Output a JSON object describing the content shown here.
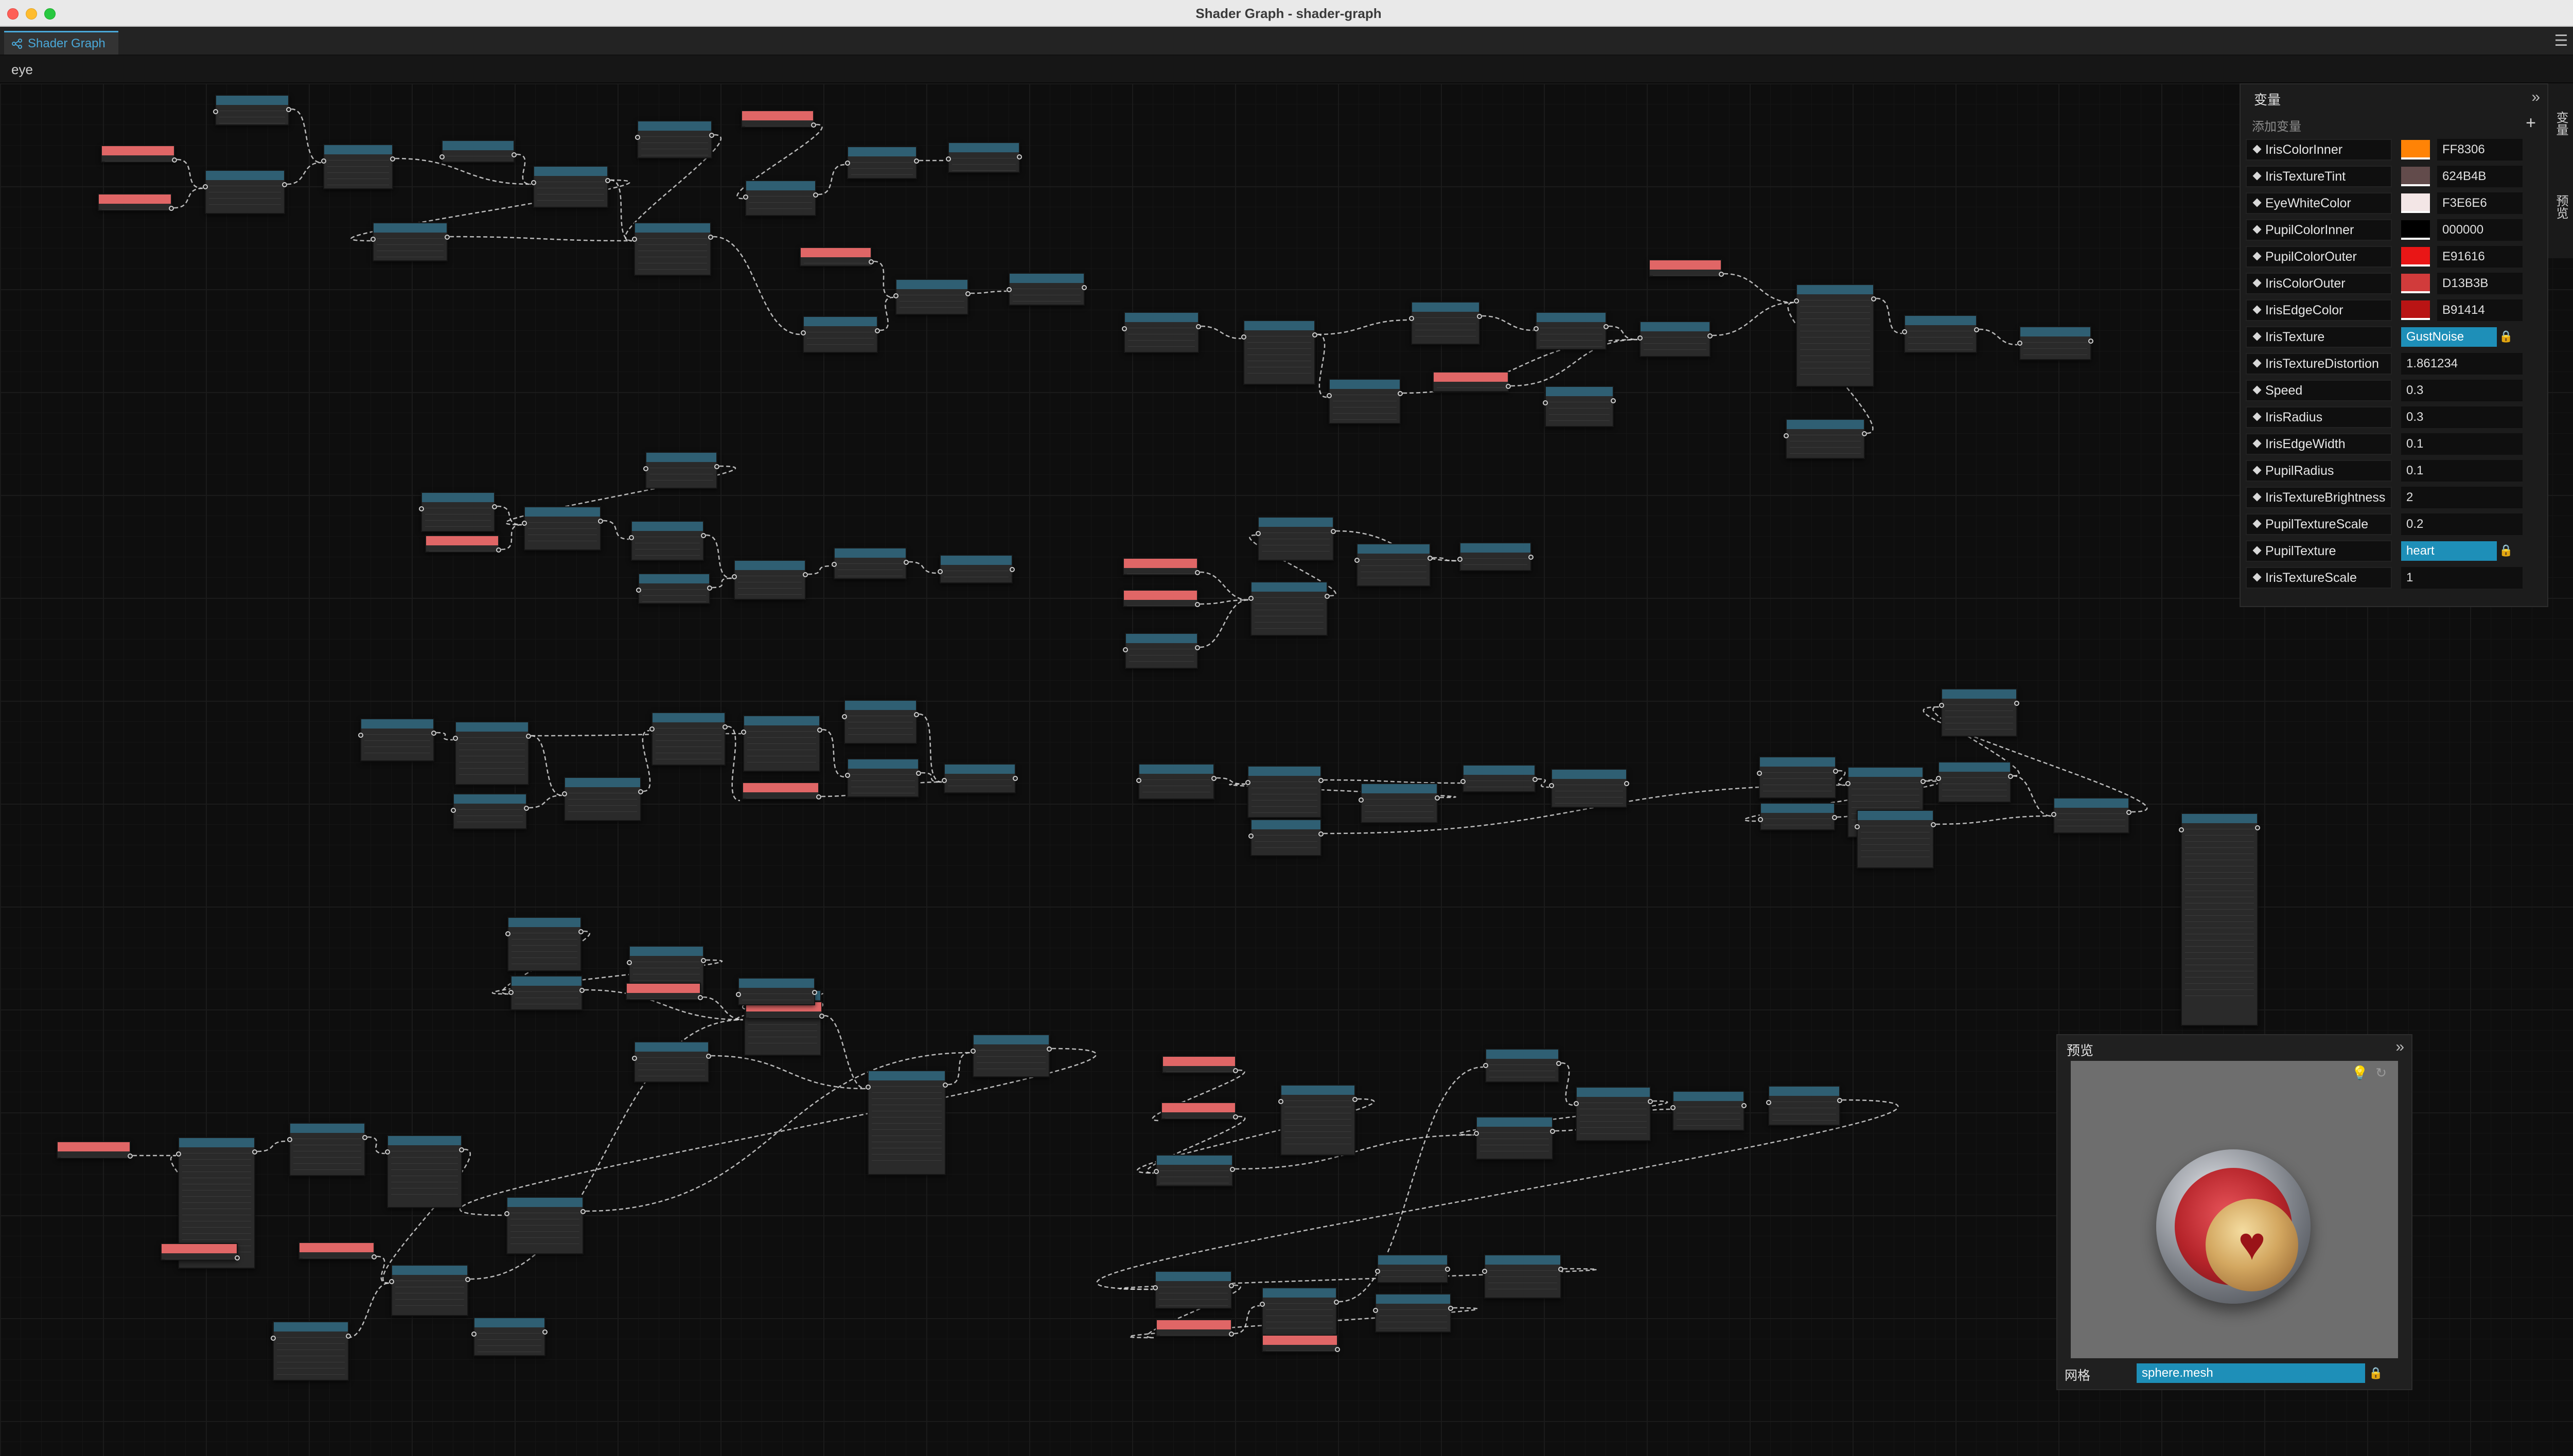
{
  "window": {
    "title": "Shader Graph - shader-graph"
  },
  "tabs": [
    {
      "label": "Shader Graph",
      "icon": "graph-icon"
    }
  ],
  "breadcrumb": "eye",
  "variables_panel": {
    "title": "变量",
    "add_label": "添加变量",
    "variables": [
      {
        "name": "IrisColorInner",
        "type": "color",
        "value": "FF8306",
        "color": "#FF8306"
      },
      {
        "name": "IrisTextureTint",
        "type": "color",
        "value": "624B4B",
        "color": "#624B4B"
      },
      {
        "name": "EyeWhiteColor",
        "type": "color",
        "value": "F3E6E6",
        "color": "#F3E6E6"
      },
      {
        "name": "PupilColorInner",
        "type": "color",
        "value": "000000",
        "color": "#000000"
      },
      {
        "name": "PupilColorOuter",
        "type": "color",
        "value": "E91616",
        "color": "#E91616"
      },
      {
        "name": "IrisColorOuter",
        "type": "color",
        "value": "D13B3B",
        "color": "#D13B3B"
      },
      {
        "name": "IrisEdgeColor",
        "type": "color",
        "value": "B91414",
        "color": "#B91414"
      },
      {
        "name": "IrisTexture",
        "type": "texture",
        "value": "GustNoise"
      },
      {
        "name": "IrisTextureDistortion",
        "type": "float",
        "value": "1.861234"
      },
      {
        "name": "Speed",
        "type": "float",
        "value": "0.3"
      },
      {
        "name": "IrisRadius",
        "type": "float",
        "value": "0.3"
      },
      {
        "name": "IrisEdgeWidth",
        "type": "float",
        "value": "0.1"
      },
      {
        "name": "PupilRadius",
        "type": "float",
        "value": "0.1"
      },
      {
        "name": "IrisTextureBrightness",
        "type": "float",
        "value": "2"
      },
      {
        "name": "PupilTextureScale",
        "type": "float",
        "value": "0.2"
      },
      {
        "name": "PupilTexture",
        "type": "texture",
        "value": "heart"
      },
      {
        "name": "IrisTextureScale",
        "type": "float",
        "value": "1"
      }
    ]
  },
  "side_tabs": {
    "variables": "变量",
    "preview": "预览"
  },
  "preview_panel": {
    "title": "预览",
    "mesh_label": "网格",
    "mesh_value": "sphere.mesh"
  },
  "colors": {
    "accent": "#4aa8d8",
    "field_blue": "#1e8fb8",
    "node_header": "#2f5f73",
    "property_node": "#e06666"
  }
}
